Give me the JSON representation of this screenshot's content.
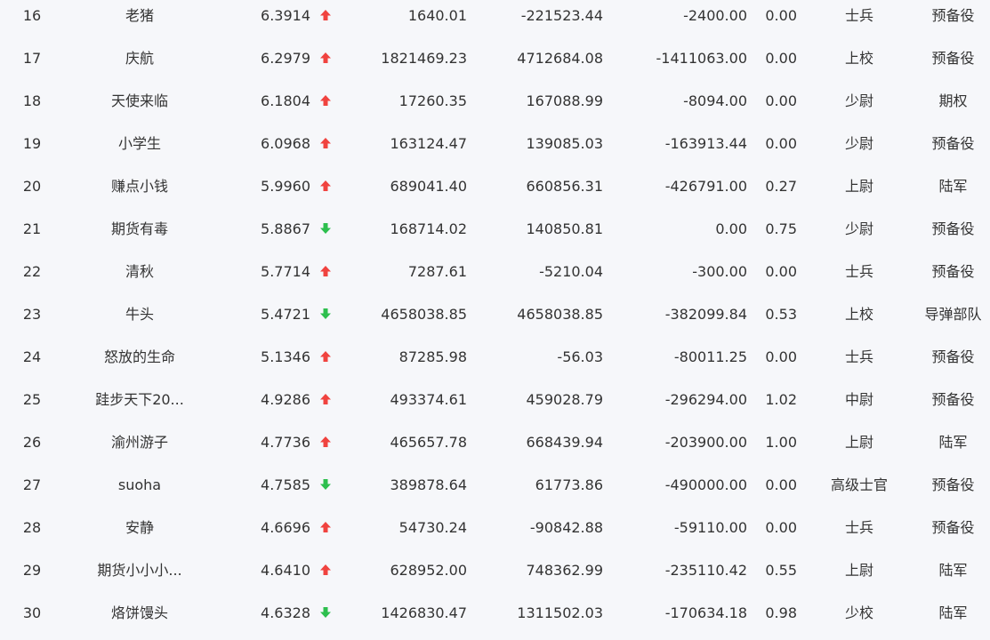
{
  "theme": {
    "up_color": "#f0433f",
    "down_color": "#2dbf4e"
  },
  "rows": [
    {
      "rank": "16",
      "name": "老猪",
      "score": "6.3914",
      "trend": "up",
      "v1": "1640.01",
      "v2": "-221523.44",
      "v3": "-2400.00",
      "ratio": "0.00",
      "military_rank": "士兵",
      "unit": "预备役"
    },
    {
      "rank": "17",
      "name": "庆航",
      "score": "6.2979",
      "trend": "up",
      "v1": "1821469.23",
      "v2": "4712684.08",
      "v3": "-1411063.00",
      "ratio": "0.00",
      "military_rank": "上校",
      "unit": "预备役"
    },
    {
      "rank": "18",
      "name": "天使来临",
      "score": "6.1804",
      "trend": "up",
      "v1": "17260.35",
      "v2": "167088.99",
      "v3": "-8094.00",
      "ratio": "0.00",
      "military_rank": "少尉",
      "unit": "期权"
    },
    {
      "rank": "19",
      "name": "小学生",
      "score": "6.0968",
      "trend": "up",
      "v1": "163124.47",
      "v2": "139085.03",
      "v3": "-163913.44",
      "ratio": "0.00",
      "military_rank": "少尉",
      "unit": "预备役"
    },
    {
      "rank": "20",
      "name": "赚点小钱",
      "score": "5.9960",
      "trend": "up",
      "v1": "689041.40",
      "v2": "660856.31",
      "v3": "-426791.00",
      "ratio": "0.27",
      "military_rank": "上尉",
      "unit": "陆军"
    },
    {
      "rank": "21",
      "name": "期货有毒",
      "score": "5.8867",
      "trend": "down",
      "v1": "168714.02",
      "v2": "140850.81",
      "v3": "0.00",
      "ratio": "0.75",
      "military_rank": "少尉",
      "unit": "预备役"
    },
    {
      "rank": "22",
      "name": "清秋",
      "score": "5.7714",
      "trend": "up",
      "v1": "7287.61",
      "v2": "-5210.04",
      "v3": "-300.00",
      "ratio": "0.00",
      "military_rank": "士兵",
      "unit": "预备役"
    },
    {
      "rank": "23",
      "name": "牛头",
      "score": "5.4721",
      "trend": "down",
      "v1": "4658038.85",
      "v2": "4658038.85",
      "v3": "-382099.84",
      "ratio": "0.53",
      "military_rank": "上校",
      "unit": "导弹部队"
    },
    {
      "rank": "24",
      "name": "怒放的生命",
      "score": "5.1346",
      "trend": "up",
      "v1": "87285.98",
      "v2": "-56.03",
      "v3": "-80011.25",
      "ratio": "0.00",
      "military_rank": "士兵",
      "unit": "预备役"
    },
    {
      "rank": "25",
      "name": "跬步天下20...",
      "score": "4.9286",
      "trend": "up",
      "v1": "493374.61",
      "v2": "459028.79",
      "v3": "-296294.00",
      "ratio": "1.02",
      "military_rank": "中尉",
      "unit": "预备役"
    },
    {
      "rank": "26",
      "name": "渝州游子",
      "score": "4.7736",
      "trend": "up",
      "v1": "465657.78",
      "v2": "668439.94",
      "v3": "-203900.00",
      "ratio": "1.00",
      "military_rank": "上尉",
      "unit": "陆军"
    },
    {
      "rank": "27",
      "name": "suoha",
      "score": "4.7585",
      "trend": "down",
      "v1": "389878.64",
      "v2": "61773.86",
      "v3": "-490000.00",
      "ratio": "0.00",
      "military_rank": "高级士官",
      "unit": "预备役"
    },
    {
      "rank": "28",
      "name": "安静",
      "score": "4.6696",
      "trend": "up",
      "v1": "54730.24",
      "v2": "-90842.88",
      "v3": "-59110.00",
      "ratio": "0.00",
      "military_rank": "士兵",
      "unit": "预备役"
    },
    {
      "rank": "29",
      "name": "期货小小小...",
      "score": "4.6410",
      "trend": "up",
      "v1": "628952.00",
      "v2": "748362.99",
      "v3": "-235110.42",
      "ratio": "0.55",
      "military_rank": "上尉",
      "unit": "陆军"
    },
    {
      "rank": "30",
      "name": "烙饼馒头",
      "score": "4.6328",
      "trend": "down",
      "v1": "1426830.47",
      "v2": "1311502.03",
      "v3": "-170634.18",
      "ratio": "0.98",
      "military_rank": "少校",
      "unit": "陆军"
    }
  ]
}
